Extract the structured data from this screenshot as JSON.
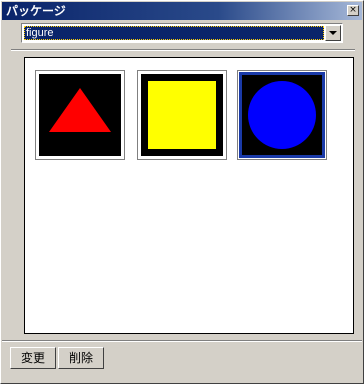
{
  "window": {
    "title": "パッケージ",
    "close_glyph": "×"
  },
  "package_select": {
    "selected": "figure"
  },
  "figures": [
    {
      "name": "triangle",
      "fill": "#ff0000",
      "selected": false
    },
    {
      "name": "square",
      "fill": "#ffff00",
      "selected": false
    },
    {
      "name": "circle",
      "fill": "#0000ff",
      "selected": true
    }
  ],
  "buttons": {
    "change_label": "変更",
    "delete_label": "削除"
  },
  "colors": {
    "title_bar": "#0a246a",
    "selection": "#0a246a",
    "selected_border": "#1a3aa8"
  }
}
